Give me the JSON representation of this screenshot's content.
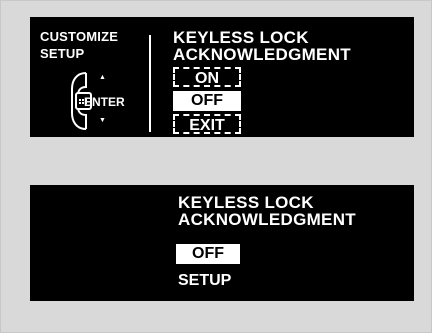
{
  "screen1": {
    "side_title": [
      "CUSTOMIZE",
      "SETUP"
    ],
    "control": {
      "enter_label": "ENTER",
      "up_arrow": "▲",
      "down_arrow": "▼",
      "icon": "selector-knob-icon"
    },
    "title": [
      "KEYLESS LOCK",
      "ACKNOWLEDGMENT"
    ],
    "options": [
      {
        "label": "ON",
        "state": "dashed"
      },
      {
        "label": "OFF",
        "state": "selected"
      },
      {
        "label": "EXIT",
        "state": "dashed"
      }
    ]
  },
  "screen2": {
    "title": [
      "KEYLESS LOCK",
      "ACKNOWLEDGMENT"
    ],
    "value": "OFF",
    "footer": "SETUP"
  },
  "colors": {
    "screen_bg": "#000000",
    "text": "#ffffff",
    "frame_bg": "#d9d9d9"
  }
}
